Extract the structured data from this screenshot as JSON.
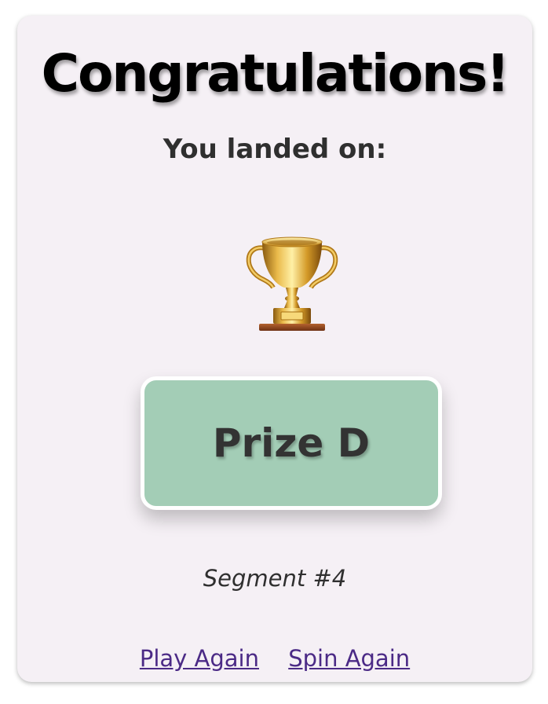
{
  "result": {
    "heading": "Congratulations!",
    "subheading": "You landed on:",
    "icon": "trophy-icon",
    "prize_label": "Prize D",
    "segment_label": "Segment #4"
  },
  "actions": {
    "play_again": "Play Again",
    "spin_again": "Spin Again"
  },
  "colors": {
    "card_background": "#f5f0f5",
    "prize_background": "#a3cdb6",
    "link": "#4b2a86"
  }
}
